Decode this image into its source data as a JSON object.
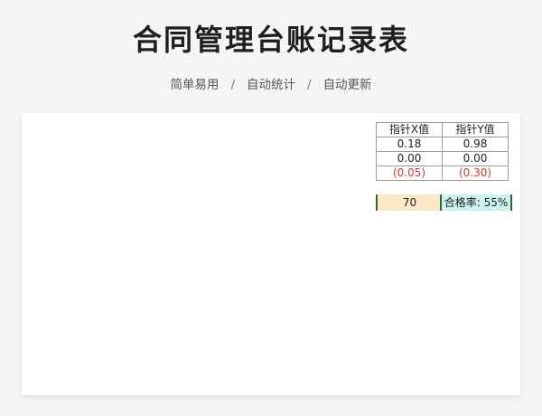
{
  "page": {
    "title": "合同管理台账记录表",
    "subtitle_items": [
      "简单易用",
      "自动统计",
      "自动更新"
    ],
    "separator": "/"
  },
  "pointer_table": {
    "headers": [
      "指针X值",
      "指针Y值"
    ],
    "rows": [
      [
        "0.18",
        "0.98"
      ],
      [
        "0.00",
        "0.00"
      ],
      [
        "(0.05)",
        "(0.30)"
      ]
    ]
  },
  "kpi": {
    "value": "70",
    "pass_rate_label": "合格率: 55%"
  },
  "colors": {
    "negative": "#c8362f",
    "kpi_value_bg": "#fbe8c6",
    "kpi_rate_bg": "#cdf3ee",
    "kpi_border": "#2e6a2e"
  }
}
